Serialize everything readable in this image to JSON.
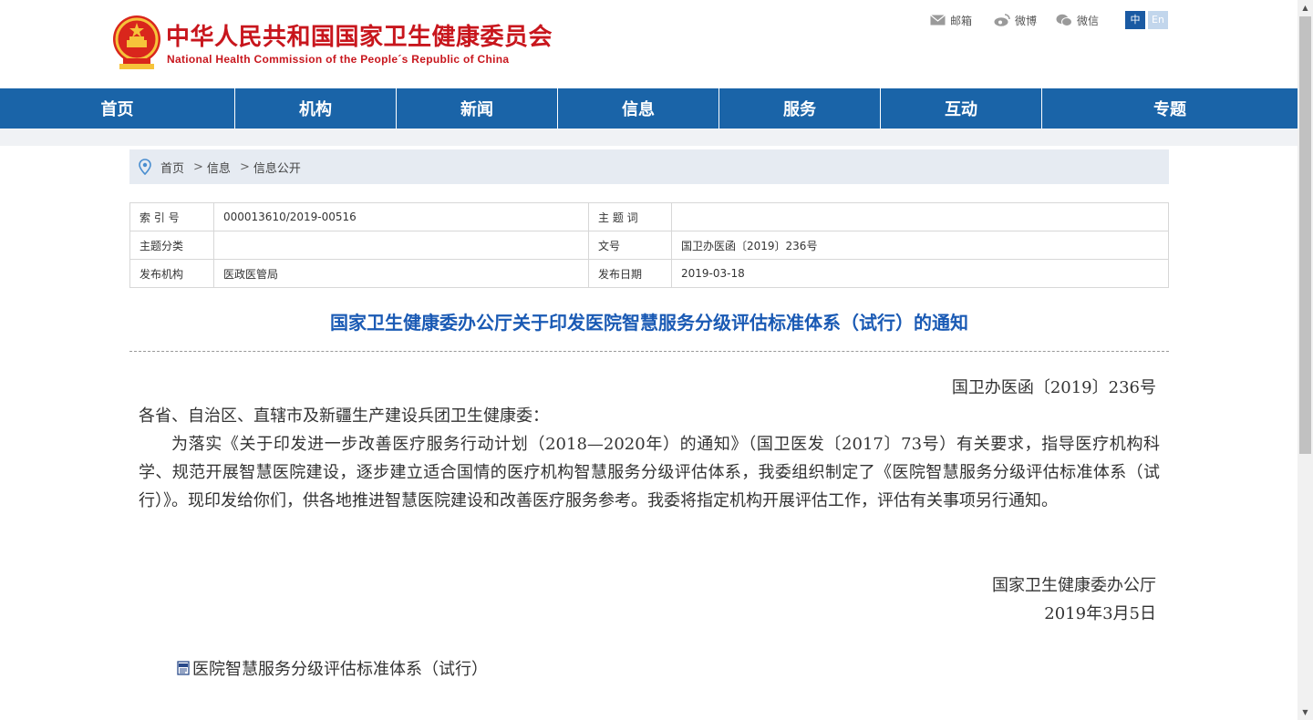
{
  "header": {
    "title_cn": "中华人民共和国国家卫生健康委员会",
    "title_en": "National Health Commission of the People´s Republic of China",
    "links": [
      {
        "label": "邮箱",
        "icon": "mail-icon"
      },
      {
        "label": "微博",
        "icon": "weibo-icon"
      },
      {
        "label": "微信",
        "icon": "wechat-icon"
      }
    ],
    "lang_zh": "中",
    "lang_en": "En"
  },
  "nav": {
    "items": [
      "首页",
      "机构",
      "新闻",
      "信息",
      "服务",
      "互动",
      "专题"
    ]
  },
  "breadcrumb": {
    "items": [
      "首页",
      "信息",
      "信息公开"
    ],
    "separator": ">"
  },
  "meta": {
    "rows": [
      {
        "k1": "索 引 号",
        "v1": "000013610/2019-00516",
        "k2": "主 题 词",
        "v2": ""
      },
      {
        "k1": "主题分类",
        "v1": "",
        "k2": "文号",
        "v2": "国卫办医函〔2019〕236号"
      },
      {
        "k1": "发布机构",
        "v1": "医政医管局",
        "k2": "发布日期",
        "v2": "2019-03-18"
      }
    ]
  },
  "article": {
    "title": "国家卫生健康委办公厅关于印发医院智慧服务分级评估标准体系（试行）的通知",
    "doc_number": "国卫办医函〔2019〕236号",
    "addressee": "各省、自治区、直辖市及新疆生产建设兵团卫生健康委：",
    "body": "为落实《关于印发进一步改善医疗服务行动计划（2018—2020年）的通知》（国卫医发〔2017〕73号）有关要求，指导医疗机构科学、规范开展智慧医院建设，逐步建立适合国情的医疗机构智慧服务分级评估体系，我委组织制定了《医院智慧服务分级评估标准体系（试行）》。现印发给你们，供各地推进智慧医院建设和改善医疗服务参考。我委将指定机构开展评估工作，评估有关事项另行通知。",
    "signature_org": "国家卫生健康委办公厅",
    "signature_date": "2019年3月5日",
    "attachment": "医院智慧服务分级评估标准体系（试行）"
  },
  "colors": {
    "brand_red": "#c8161d",
    "nav_blue": "#1a64a8",
    "title_blue": "#1a5ab4"
  }
}
